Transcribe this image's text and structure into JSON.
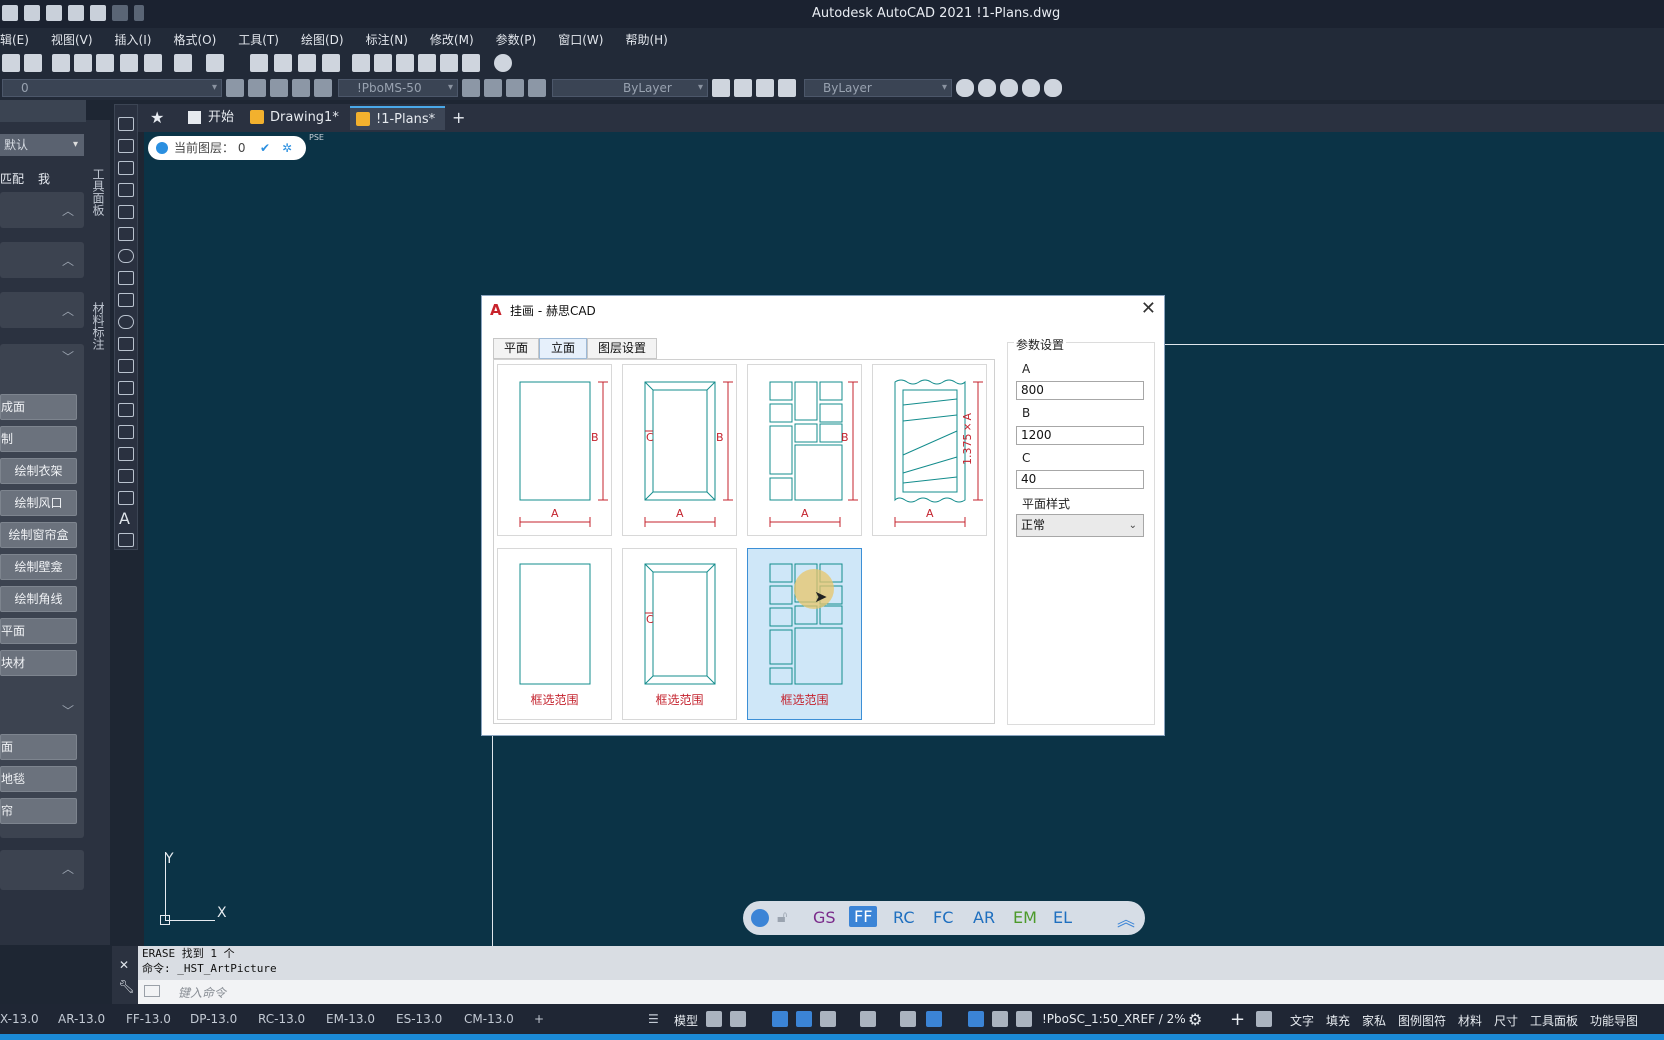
{
  "app": {
    "title": "Autodesk AutoCAD 2021    !1-Plans.dwg"
  },
  "menu": [
    "辑(E)",
    "视图(V)",
    "插入(I)",
    "格式(O)",
    "工具(T)",
    "绘图(D)",
    "标注(N)",
    "修改(M)",
    "参数(P)",
    "窗口(W)",
    "帮助(H)"
  ],
  "toolbar2": {
    "layer_value": "0",
    "dimstyle_value": "!PboMS-50",
    "linetype_value": "ByLayer",
    "color_value": "ByLayer"
  },
  "left_palette": {
    "combo": "默认",
    "row_labels": [
      "匹配",
      "我"
    ],
    "side_tab_1": "工具面板",
    "side_tab_2": "材料标注",
    "buttons_group1": [
      "成面",
      "制",
      "绘制衣架",
      "绘制风口",
      "绘制窗帘盒",
      "绘制壁龛",
      "绘制角线",
      "平面",
      "块材"
    ],
    "buttons_group2": [
      "面",
      "地毯",
      "帘"
    ]
  },
  "tabs": [
    {
      "label": "开始"
    },
    {
      "label": "Drawing1*"
    },
    {
      "label": "!1-Plans*"
    }
  ],
  "layer_indicator": {
    "label": "当前图层：",
    "value": "0",
    "badge": "PSE"
  },
  "dialog": {
    "title": "挂画 - 赫思CAD",
    "tabs": [
      "平面",
      "立面",
      "图层设置"
    ],
    "selected_tab": "立面",
    "dim_labels": {
      "a": "A",
      "b": "B",
      "c": "C",
      "ratio": "1.375×A"
    },
    "cell_caption": "框选范围",
    "params": {
      "legend": "参数设置",
      "a_label": "A",
      "a_value": "800",
      "b_label": "B",
      "b_value": "1200",
      "c_label": "C",
      "c_value": "40",
      "style_label": "平面样式",
      "style_value": "正常"
    }
  },
  "nav_pill": {
    "items": [
      "GS",
      "FF",
      "RC",
      "FC",
      "AR",
      "EM",
      "EL"
    ],
    "active": "FF"
  },
  "ucs": {
    "y": "Y",
    "x": "X"
  },
  "command": {
    "history_1": "ERASE 找到 1 个",
    "history_2": "命令: _HST_ArtPicture",
    "placeholder": "键入命令"
  },
  "layout_tabs": [
    "X-13.0",
    "AR-13.0",
    "FF-13.0",
    "DP-13.0",
    "RC-13.0",
    "EM-13.0",
    "ES-13.0",
    "CM-13.0"
  ],
  "status": {
    "model": "模型",
    "scale": "!PboSC_1:50_XREF / 2%",
    "items": [
      "文字",
      "填充",
      "家私",
      "图例图符",
      "材料",
      "尺寸",
      "工具面板",
      "功能导图"
    ]
  },
  "colors": {
    "canvas": "#0b3346",
    "accent": "#3b84d6",
    "dim_red": "#c4232e",
    "frame_teal": "#138c8c"
  }
}
